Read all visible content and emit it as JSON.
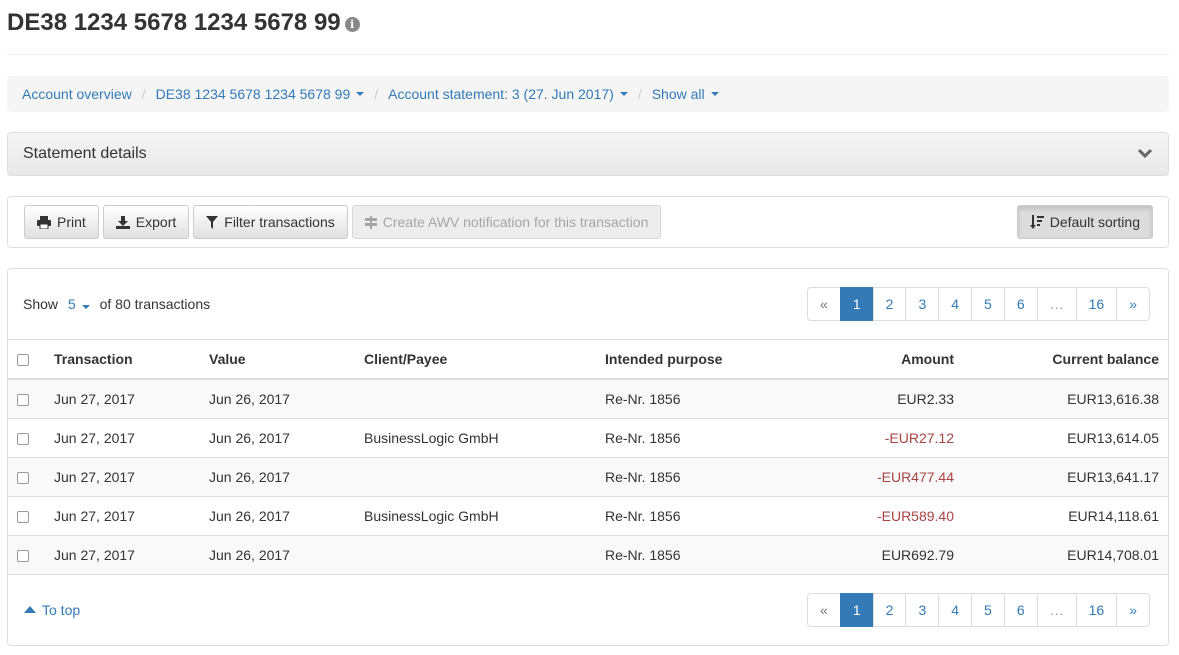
{
  "header": {
    "title": "DE38 1234 5678 1234 5678 99",
    "info_glyph": "i"
  },
  "breadcrumb": [
    {
      "label": "Account overview",
      "dropdown": false
    },
    {
      "label": "DE38 1234 5678 1234 5678 99",
      "dropdown": true
    },
    {
      "label": "Account statement: 3 (27. Jun 2017)",
      "dropdown": true
    },
    {
      "label": "Show all",
      "dropdown": true
    }
  ],
  "details": {
    "title": "Statement details"
  },
  "toolbar": {
    "print": "Print",
    "export": "Export",
    "filter": "Filter transactions",
    "awv": "Create AWV notification for this transaction",
    "sorting": "Default sorting"
  },
  "listing": {
    "show_label": "Show",
    "page_size": "5",
    "of_label": "of 80 transactions"
  },
  "pagination": {
    "prev": "«",
    "pages": [
      "1",
      "2",
      "3",
      "4",
      "5",
      "6"
    ],
    "dots": "…",
    "last": "16",
    "next": "»",
    "current": "1"
  },
  "columns": {
    "transaction": "Transaction",
    "value": "Value",
    "client": "Client/Payee",
    "purpose": "Intended purpose",
    "amount": "Amount",
    "balance": "Current balance"
  },
  "rows": [
    {
      "transaction": "Jun 27, 2017",
      "value": "Jun 26, 2017",
      "client": "",
      "purpose": "Re-Nr. 1856",
      "amount": "EUR2.33",
      "balance": "EUR13,616.38"
    },
    {
      "transaction": "Jun 27, 2017",
      "value": "Jun 26, 2017",
      "client": "BusinessLogic GmbH",
      "purpose": "Re-Nr. 1856",
      "amount": "-EUR27.12",
      "balance": "EUR13,614.05"
    },
    {
      "transaction": "Jun 27, 2017",
      "value": "Jun 26, 2017",
      "client": "",
      "purpose": "Re-Nr. 1856",
      "amount": "-EUR477.44",
      "balance": "EUR13,641.17"
    },
    {
      "transaction": "Jun 27, 2017",
      "value": "Jun 26, 2017",
      "client": "BusinessLogic GmbH",
      "purpose": "Re-Nr. 1856",
      "amount": "-EUR589.40",
      "balance": "EUR14,118.61"
    },
    {
      "transaction": "Jun 27, 2017",
      "value": "Jun 26, 2017",
      "client": "",
      "purpose": "Re-Nr. 1856",
      "amount": "EUR692.79",
      "balance": "EUR14,708.01"
    }
  ],
  "footer": {
    "to_top": "To top"
  },
  "colors": {
    "link": "#337ab7",
    "negative": "#a94442",
    "active_page": "#337ab7"
  },
  "icons": {
    "print": "printer-icon",
    "export": "download-icon",
    "filter": "filter-icon",
    "awv": "signpost-icon",
    "sorting": "sort-icon",
    "details": "chevron-down-icon",
    "to_top": "triangle-up-icon"
  }
}
